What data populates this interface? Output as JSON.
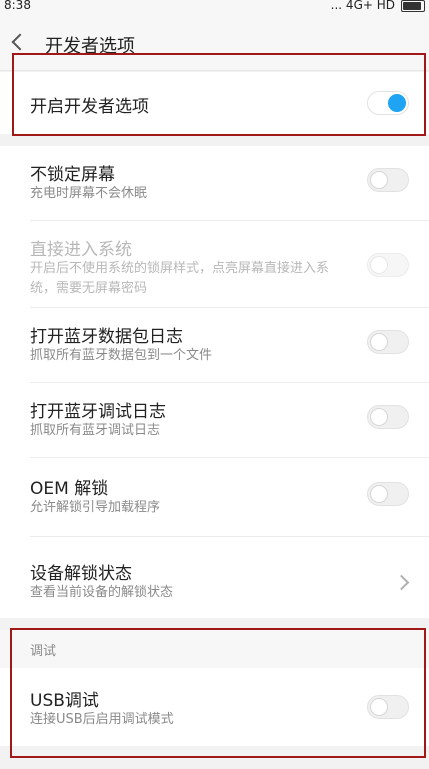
{
  "status_bar": {
    "time": "8:38",
    "right_text": "... 4G+ HD"
  },
  "header": {
    "title": "开发者选项"
  },
  "master": {
    "label": "开启开发者选项",
    "enabled": true
  },
  "items": [
    {
      "title": "不锁定屏幕",
      "subtitle": "充电时屏幕不会休眠",
      "toggle": false,
      "disabled": false
    },
    {
      "title": "直接进入系统",
      "subtitle": "开启后不使用系统的锁屏样式，点亮屏幕直接进入系统，需要无屏幕密码",
      "toggle": false,
      "disabled": true
    },
    {
      "title": "打开蓝牙数据包日志",
      "subtitle": "抓取所有蓝牙数据包到一个文件",
      "toggle": false,
      "disabled": false
    },
    {
      "title": "打开蓝牙调试日志",
      "subtitle": "抓取所有蓝牙调试日志",
      "toggle": false,
      "disabled": false
    },
    {
      "title": "OEM 解锁",
      "subtitle": "允许解锁引导加载程序",
      "toggle": false,
      "disabled": false
    },
    {
      "title": "设备解锁状态",
      "subtitle": "查看当前设备的解锁状态",
      "chevron": true
    }
  ],
  "debug_section": {
    "label": "调试",
    "item": {
      "title": "USB调试",
      "subtitle": "连接USB后启用调试模式",
      "toggle": false
    }
  },
  "colors": {
    "accent": "#1ea4f2",
    "highlight_border": "#a01818"
  }
}
